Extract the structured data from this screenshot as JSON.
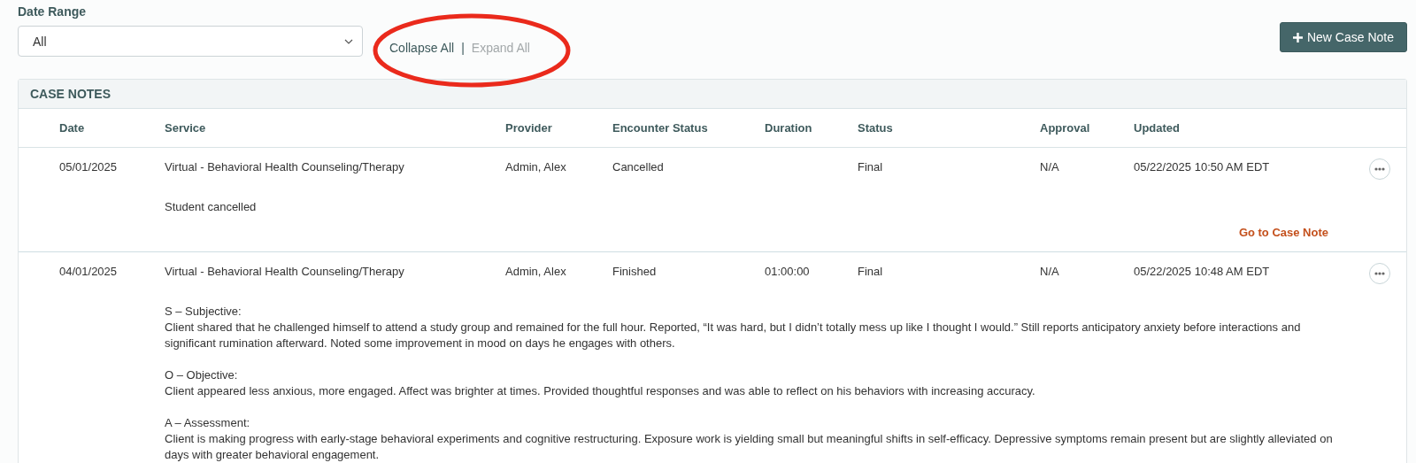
{
  "date_range": {
    "label": "Date Range",
    "value": "All"
  },
  "view_links": [
    {
      "label": "Collapse All",
      "disabled": false
    },
    {
      "label": "Expand All",
      "disabled": true
    }
  ],
  "view_links_separator": "|",
  "new_button": {
    "label": "New Case Note"
  },
  "case_notes": {
    "title": "CASE NOTES",
    "columns": [
      "Date",
      "Service",
      "Provider",
      "Encounter Status",
      "Duration",
      "Status",
      "Approval",
      "Updated"
    ],
    "rows": [
      {
        "cells": [
          "05/01/2025",
          "Virtual - Behavioral Health Counseling/Therapy",
          "Admin, Alex",
          "Cancelled",
          "",
          "Final",
          "N/A",
          "05/22/2025 10:50 AM EDT"
        ],
        "note": [
          {
            "text": "Student cancelled"
          }
        ],
        "link": "Go to Case Note"
      },
      {
        "cells": [
          "04/01/2025",
          "Virtual - Behavioral Health Counseling/Therapy",
          "Admin, Alex",
          "Finished",
          "01:00:00",
          "Final",
          "N/A",
          "05/22/2025 10:48 AM EDT"
        ],
        "note": [
          {
            "heading": "S – Subjective:",
            "text": "Client shared that he challenged himself to attend a study group and remained for the full hour. Reported, “It was hard, but I didn’t totally mess up like I thought I would.” Still reports anticipatory anxiety before interactions and significant rumination afterward. Noted some improvement in mood on days he engages with others."
          },
          {
            "heading": "O – Objective:",
            "text": "Client appeared less anxious, more engaged. Affect was brighter at times. Provided thoughtful responses and was able to reflect on his behaviors with increasing accuracy."
          },
          {
            "heading": "A – Assessment:",
            "text": "Client is making progress with early-stage behavioral experiments and cognitive restructuring. Exposure work is yielding small but meaningful shifts in self-efficacy. Depressive symptoms remain present but are slightly alleviated on days with greater behavioral engagement."
          }
        ]
      }
    ]
  }
}
